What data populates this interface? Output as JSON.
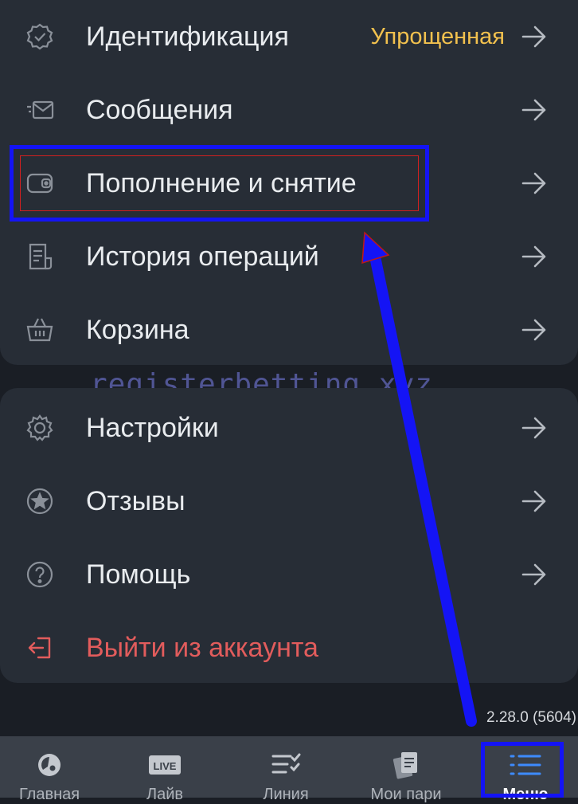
{
  "menu_group_1": [
    {
      "label": "Идентификация",
      "badge": "Упрощенная",
      "icon": "verified-badge-icon"
    },
    {
      "label": "Сообщения",
      "icon": "message-envelope-icon"
    },
    {
      "label": "Пополнение и снятие",
      "icon": "wallet-icon"
    },
    {
      "label": "История операций",
      "icon": "history-receipt-icon"
    },
    {
      "label": "Корзина",
      "icon": "basket-icon"
    }
  ],
  "menu_group_2": [
    {
      "label": "Настройки",
      "icon": "gear-icon"
    },
    {
      "label": "Отзывы",
      "icon": "star-icon"
    },
    {
      "label": "Помощь",
      "icon": "help-icon"
    },
    {
      "label": "Выйти из аккаунта",
      "icon": "logout-icon"
    }
  ],
  "watermark": "registerbetting.xyz",
  "version": "2.28.0 (5604)",
  "bottom_nav": [
    {
      "label": "Главная",
      "icon": "home-icon"
    },
    {
      "label": "Лайв",
      "icon": "live-icon",
      "icon_text": "LIVE"
    },
    {
      "label": "Линия",
      "icon": "line-list-icon"
    },
    {
      "label": "Мои пари",
      "icon": "my-bets-icon"
    },
    {
      "label": "Меню",
      "icon": "menu-icon"
    }
  ],
  "colors": {
    "background": "#1a1e25",
    "card": "#272d36",
    "text": "#e9ecef",
    "badge": "#f2c14e",
    "logout": "#e25c5c",
    "annotation": "#1414f5"
  }
}
